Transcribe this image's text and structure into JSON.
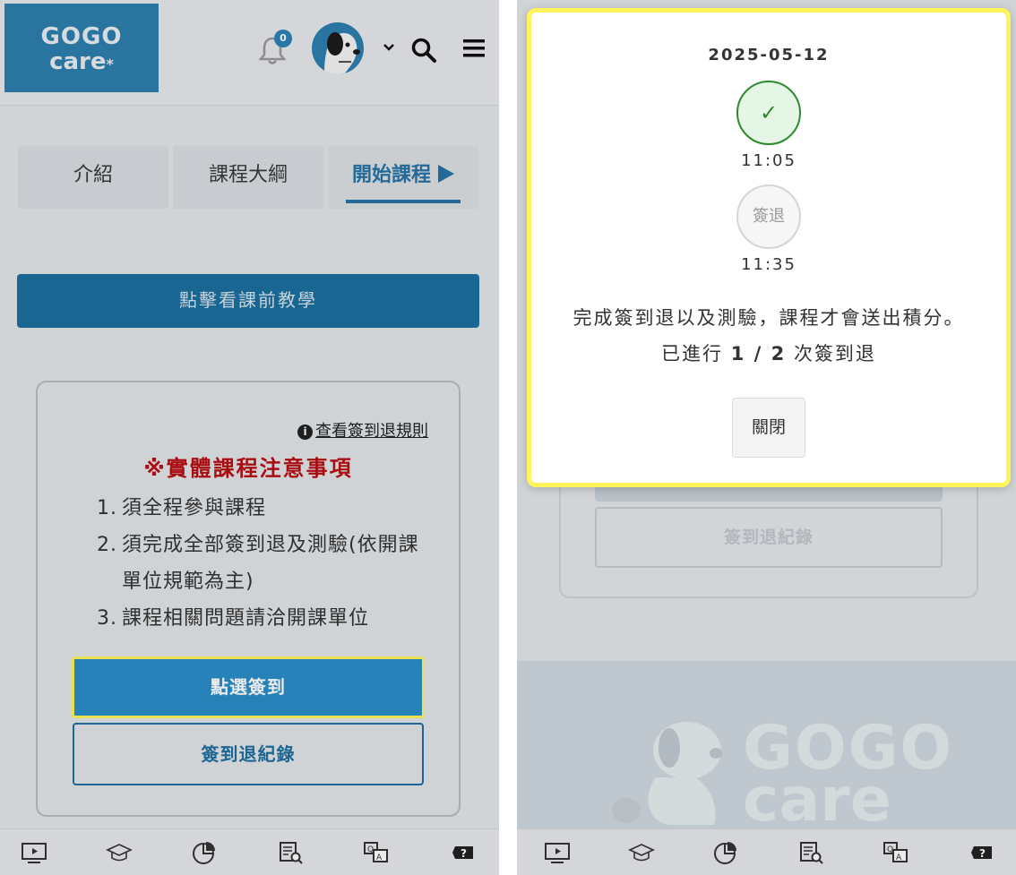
{
  "header": {
    "logo_line1": "GOGO",
    "logo_line2": "care",
    "logo_star": "*",
    "notification_count": "0"
  },
  "tabs": [
    {
      "label": "介紹",
      "active": false
    },
    {
      "label": "課程大綱",
      "active": false
    },
    {
      "label": "開始課程",
      "active": true
    }
  ],
  "teach_button": "點擊看課前教學",
  "card": {
    "rules_link": "查看簽到退規則",
    "notice_title": "※實體課程注意事項",
    "notices": [
      {
        "num": "1.",
        "text": "須全程參與課程"
      },
      {
        "num": "2.",
        "text": "須完成全部簽到退及測驗(依開課單位規範為主)"
      },
      {
        "num": "3.",
        "text": "課程相關問題請洽開課單位"
      }
    ],
    "checkin_button": "點選簽到",
    "record_button": "簽到退紀錄"
  },
  "right_background": {
    "record_button": "簽到退紀錄",
    "footer_word1": "GOGO",
    "footer_word2": "care"
  },
  "modal": {
    "date": "2025-05-12",
    "checkin_mark": "✓",
    "checkin_time": "11:05",
    "checkout_label": "簽退",
    "checkout_time": "11:35",
    "message": "完成簽到退以及測驗，課程才會送出積分。",
    "progress_prefix": "已進行",
    "progress_value": "1 / 2",
    "progress_suffix": "次簽到退",
    "close_button": "關閉"
  },
  "bottom_nav": [
    "tv-icon",
    "graduation-cap-icon",
    "pie-chart-icon",
    "document-search-icon",
    "qa-icon",
    "help-ticket-icon"
  ],
  "colors": {
    "brand_blue": "#2e7fae",
    "checkin_blue": "#2a8ec8",
    "notice_red": "#b80f13",
    "highlight_yellow": "#fff45a",
    "success_green": "#2b8a2b"
  }
}
